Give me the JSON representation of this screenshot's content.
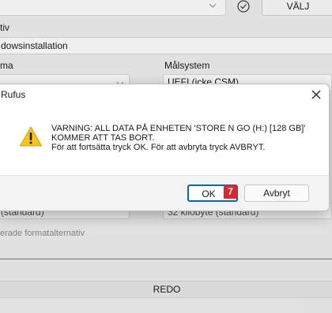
{
  "window": {
    "boot_selection_label": "VÄLJ",
    "section_label_partial": "tiv",
    "image_option_value": "dowsinstallation",
    "partition_scheme_label": "ma",
    "target_system_label": "Målsystem",
    "target_system_value": "UEFI (icke CSM)",
    "filesystem_value_partial": "(standard)",
    "cluster_value_partial": "32 kilobyte (standard)",
    "advanced_format_label": "erade formatalternativ",
    "status_text": "REDO"
  },
  "dialog": {
    "title": "Rufus",
    "message_line1": "VARNING: ALL DATA PÅ ENHETEN 'STORE N GO (H:) [128 GB]'",
    "message_line2": "KOMMER ATT TAS BORT.",
    "message_line3": "För att fortsätta tryck OK. För att avbryta tryck AVBRYT.",
    "ok_label": "OK",
    "cancel_label": "Avbryt",
    "annotation_number": "7"
  }
}
